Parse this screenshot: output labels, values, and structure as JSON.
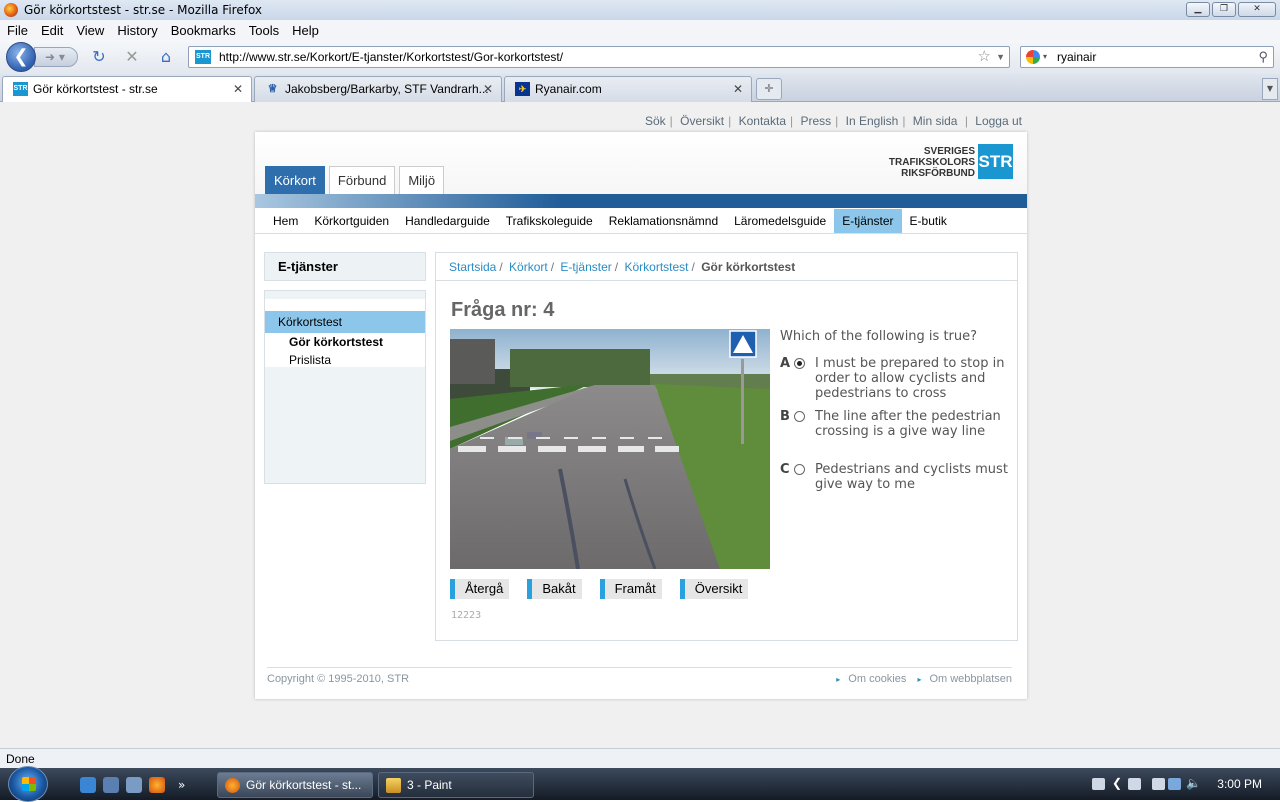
{
  "window": {
    "title": "Gör körkortstest - str.se - Mozilla Firefox"
  },
  "menu": [
    "File",
    "Edit",
    "View",
    "History",
    "Bookmarks",
    "Tools",
    "Help"
  ],
  "toolbar": {
    "url": "http://www.str.se/Korkort/E-tjanster/Korkortstest/Gor-korkortstest/",
    "search_value": "ryainair"
  },
  "tabs": [
    {
      "label": "Gör körkortstest - str.se",
      "active": true
    },
    {
      "label": "Jakobsberg/Barkarby, STF Vandrarh...",
      "active": false
    },
    {
      "label": "Ryanair.com",
      "active": false
    }
  ],
  "site": {
    "utility_links": [
      "Sök",
      "Översikt",
      "Kontakta",
      "Press",
      "In English",
      "Min sida",
      "Logga ut"
    ],
    "logo_lines": [
      "SVERIGES",
      "TRAFIKSKOLORS",
      "RIKSFÖRBUND"
    ],
    "logo_mark": "STR",
    "main_tabs": [
      {
        "label": "Körkort",
        "active": true
      },
      {
        "label": "Förbund",
        "active": false
      },
      {
        "label": "Miljö",
        "active": false
      }
    ],
    "subnav": [
      {
        "label": "Hem"
      },
      {
        "label": "Körkortguiden"
      },
      {
        "label": "Handledarguide"
      },
      {
        "label": "Trafikskoleguide"
      },
      {
        "label": "Reklamationsnämnd"
      },
      {
        "label": "Läromedelsguide"
      },
      {
        "label": "E-tjänster",
        "active": true
      },
      {
        "label": "E-butik"
      }
    ],
    "sidebar": {
      "heading": "E-tjänster",
      "item": "Körkortstest",
      "subitems": [
        "Gör körkortstest",
        "Prislista"
      ]
    },
    "breadcrumb": [
      "Startsida",
      "Körkort",
      "E-tjänster",
      "Körkortstest",
      "Gör körkortstest"
    ],
    "question": {
      "title": "Fråga nr: 4",
      "text": "Which of the following is true?",
      "options": [
        {
          "letter": "A",
          "text": "I must be prepared to stop in order to allow cyclists and pedestrians to cross",
          "selected": true
        },
        {
          "letter": "B",
          "text": "The line after the pedestrian crossing is a give way line",
          "selected": false
        },
        {
          "letter": "C",
          "text": "Pedestrians and cyclists must give way to me",
          "selected": false
        }
      ],
      "buttons": [
        "Återgå",
        "Bakåt",
        "Framåt",
        "Översikt"
      ],
      "id": "12223"
    },
    "footer": {
      "copyright": "Copyright © 1995-2010, STR",
      "links": [
        "Om cookies",
        "Om webbplatsen"
      ]
    }
  },
  "statusbar": {
    "text": "Done"
  },
  "taskbar": {
    "items": [
      {
        "label": "Gör körkortstest - st...",
        "active": true
      },
      {
        "label": "3 - Paint",
        "active": false
      }
    ],
    "clock": "3:00 PM"
  },
  "colors": {
    "accent": "#2b8cc4",
    "tab_active": "#2e6ead",
    "nav_highlight": "#8cc6ea",
    "button_marker": "#2aa0dc"
  }
}
